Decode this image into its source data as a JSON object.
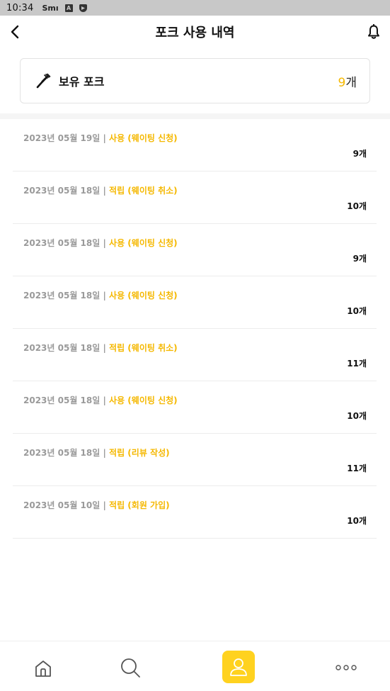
{
  "status_bar": {
    "time": "10:34",
    "glyph1": "Smı",
    "glyph2": "A"
  },
  "header": {
    "title": "포크 사용 내역",
    "back_icon": "chevron-left-icon",
    "bell_icon": "bell-icon"
  },
  "balance": {
    "label": "보유 포크",
    "icon": "fork-icon",
    "amount": "9",
    "unit": "개"
  },
  "history": [
    {
      "date": "2023년 05월 19일",
      "separator": " | ",
      "type": "사용 (웨이팅 신청)",
      "count": "9개"
    },
    {
      "date": "2023년 05월 18일",
      "separator": " | ",
      "type": "적립 (웨이팅 취소)",
      "count": "10개"
    },
    {
      "date": "2023년 05월 18일",
      "separator": " | ",
      "type": "사용 (웨이팅 신청)",
      "count": "9개"
    },
    {
      "date": "2023년 05월 18일",
      "separator": " | ",
      "type": "사용 (웨이팅 신청)",
      "count": "10개"
    },
    {
      "date": "2023년 05월 18일",
      "separator": " | ",
      "type": "적립 (웨이팅 취소)",
      "count": "11개"
    },
    {
      "date": "2023년 05월 18일",
      "separator": " | ",
      "type": "사용 (웨이팅 신청)",
      "count": "10개"
    },
    {
      "date": "2023년 05월 18일",
      "separator": " | ",
      "type": "적립 (리뷰 작성)",
      "count": "11개"
    },
    {
      "date": "2023년 05월 10일",
      "separator": " | ",
      "type": "적립 (회원 가입)",
      "count": "10개"
    }
  ],
  "bottom_nav": {
    "items": [
      "home-icon",
      "search-icon",
      "user-icon",
      "more-icon"
    ],
    "active": "user-icon"
  },
  "colors": {
    "accent": "#f5b800",
    "active_tab_bg": "#ffd21f",
    "meta_text": "#9a9a9a"
  }
}
